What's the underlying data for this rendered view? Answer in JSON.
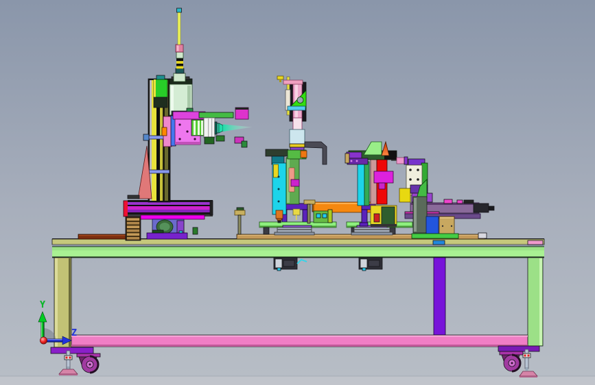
{
  "axis_triad": {
    "y_label": "Y",
    "z_label": "Z",
    "y_axis_color": "#00bb22",
    "z_axis_color": "#2233dd",
    "origin_color": "#ee2222"
  },
  "palette": {
    "background_top": "#8a96aa",
    "background_mid": "#a8afbc",
    "background_bottom": "#b8bec6",
    "ground": "#c2c6cb",
    "table_top_khaki": "#c6c87c",
    "table_apron_green": "#a9f193",
    "table_apron_green2": "#9ce287",
    "table_shelf_pink": "#f07ec5",
    "table_leg_khaki": "#c2c275",
    "table_leg_green": "#9ce087",
    "support_post_purple": "#7713d9",
    "caster_magenta": "#a03aa0",
    "fixture_plate_tan": "#c49a58",
    "column_stripe_yellow": "#e8e23c",
    "cylinder_pale_green": "#d4ecd4",
    "needle_yellow": "#ecf25c",
    "gusset_salmon": "#e07878",
    "rail_magenta": "#cc22cc",
    "base_purple": "#7722cc",
    "rotary_blue": "#6b6bcc",
    "slide_cyan": "#1dd4ea",
    "slide_red": "#ee0808",
    "beam_orange": "#f5880f",
    "nozzle_teal": "#22ddaa",
    "head_pink": "#ee77ee",
    "motor_magenta": "#dd22dd",
    "frame_purple": "#5a22bb",
    "plate_green": "#8ef07e",
    "pink_cylinder": "#eeaacc",
    "gripper_orange": "#dd7722",
    "actuator_purple": "#8a6a9a",
    "box_blue": "#2255dd",
    "box_tan": "#c8a860",
    "panel_cream": "#f0eedd",
    "arm_dark_green": "#2e5e2e",
    "bracket_green": "#33dd11",
    "angled_plate_green": "#99ee88"
  }
}
